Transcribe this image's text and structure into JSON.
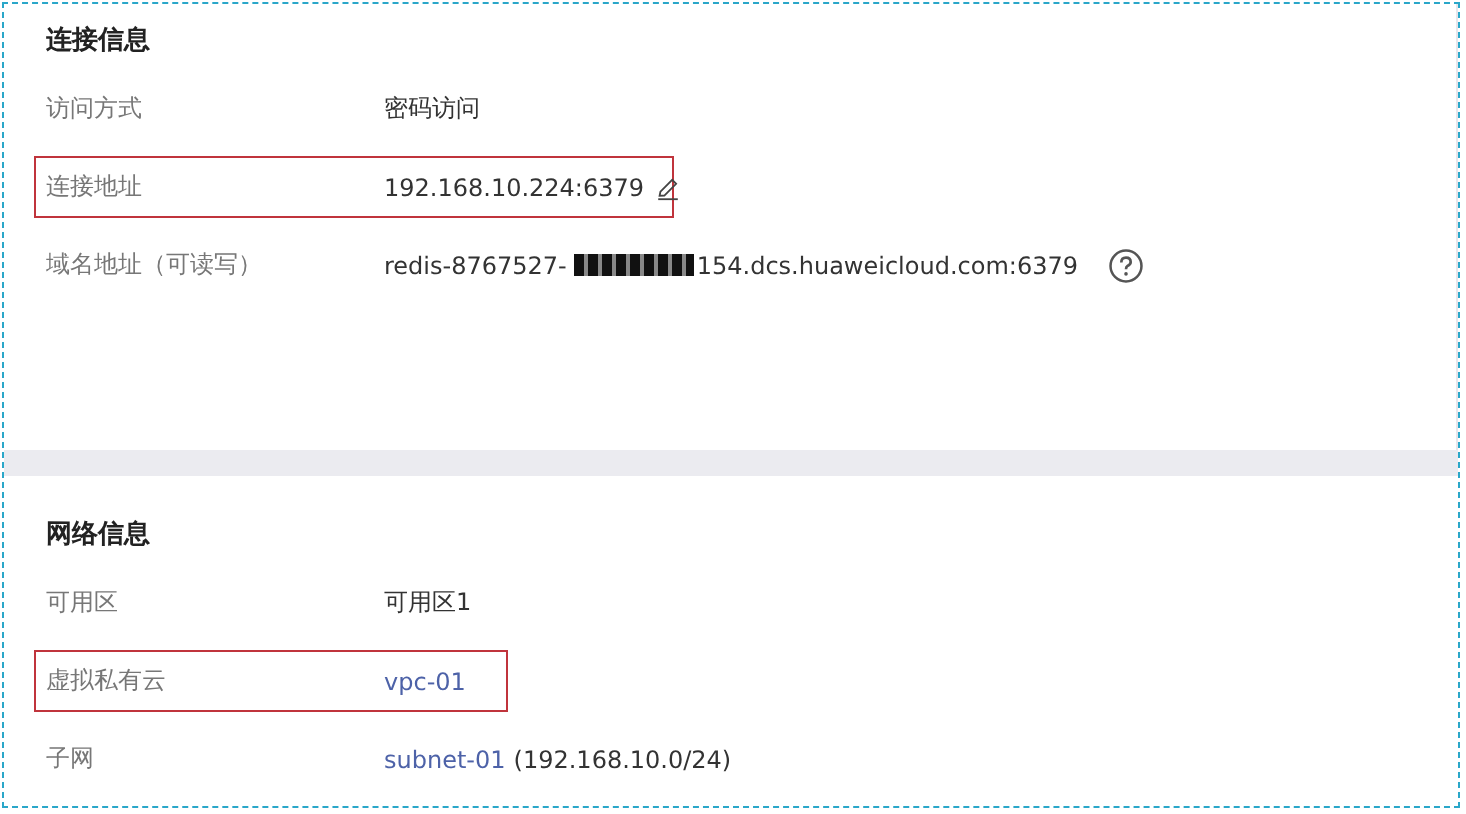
{
  "sections": [
    {
      "title": "连接信息",
      "rows": [
        {
          "label": "访问方式",
          "highlighted": false,
          "parts": [
            {
              "kind": "text",
              "text": "密码访问"
            }
          ]
        },
        {
          "label": "连接地址",
          "highlighted": true,
          "parts": [
            {
              "kind": "text",
              "text": "192.168.10.224:6379"
            },
            {
              "kind": "edit"
            }
          ]
        },
        {
          "label": "域名地址（可读写）",
          "highlighted": false,
          "parts": [
            {
              "kind": "text",
              "text": "redis-8767527-"
            },
            {
              "kind": "redaction"
            },
            {
              "kind": "text",
              "text": "154.dcs.huaweicloud.com:6379"
            },
            {
              "kind": "help"
            }
          ]
        }
      ]
    },
    {
      "title": "网络信息",
      "rows": [
        {
          "label": "可用区",
          "highlighted": false,
          "parts": [
            {
              "kind": "text",
              "text": "可用区1"
            }
          ]
        },
        {
          "label": "虚拟私有云",
          "highlighted": true,
          "parts": [
            {
              "kind": "link",
              "text": "vpc-01"
            }
          ]
        },
        {
          "label": "子网",
          "highlighted": false,
          "parts": [
            {
              "kind": "link",
              "text": "subnet-01"
            },
            {
              "kind": "text",
              "text": "(192.168.10.0/24)"
            }
          ]
        }
      ]
    }
  ]
}
